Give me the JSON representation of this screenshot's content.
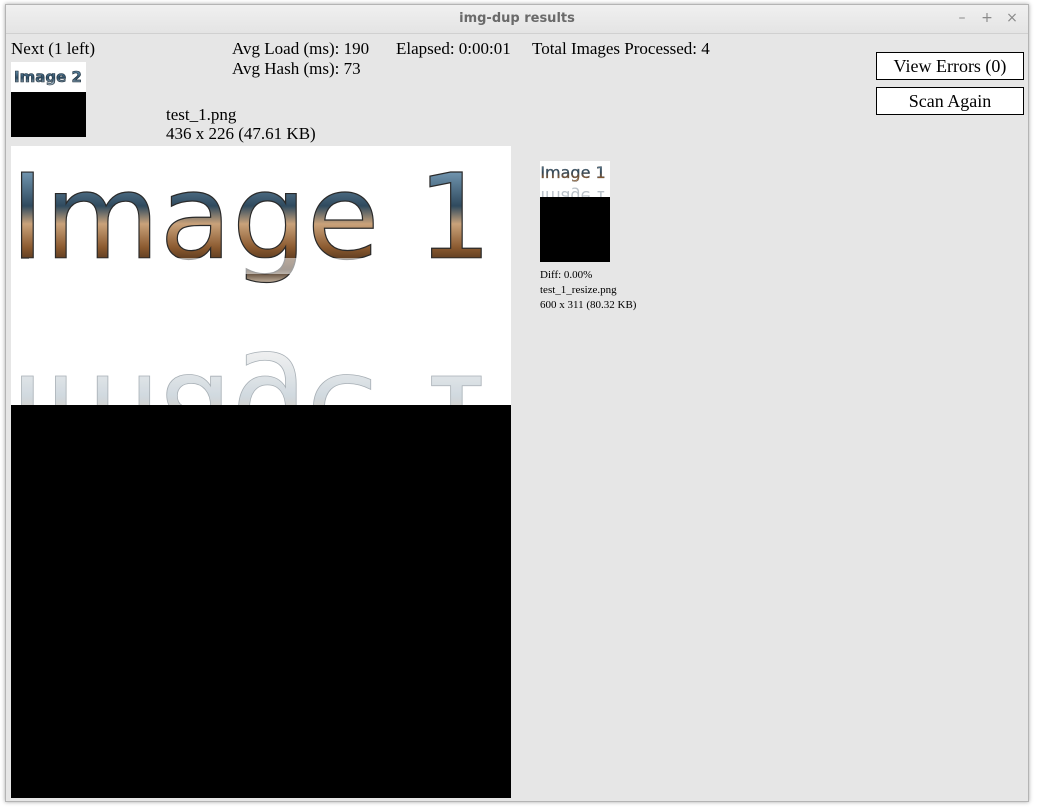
{
  "window": {
    "title": "img-dup results",
    "controls": {
      "minimize": "–",
      "maximize": "+",
      "close": "×"
    }
  },
  "status": {
    "next": "Next (1 left)",
    "avg_load": "Avg Load (ms): 190",
    "avg_hash": "Avg Hash (ms): 73",
    "elapsed": "Elapsed: 0:00:01",
    "total": "Total Images Processed: 4"
  },
  "buttons": {
    "view_errors": "View Errors (0)",
    "scan_again": "Scan Again"
  },
  "next_thumb": {
    "label": "Image 2"
  },
  "current": {
    "filename": "test_1.png",
    "dims": "436 x 226 (47.61 KB)",
    "image_label": "Image 1"
  },
  "match": {
    "image_label": "Image 1",
    "diff": "Diff: 0.00%",
    "filename": "test_1_resize.png",
    "dims": "600 x 311 (80.32 KB)"
  },
  "colors": {
    "window_bg": "#e6e6e6",
    "metal_steel": "#5c7f99",
    "metal_bronze": "#7a4f2a"
  }
}
